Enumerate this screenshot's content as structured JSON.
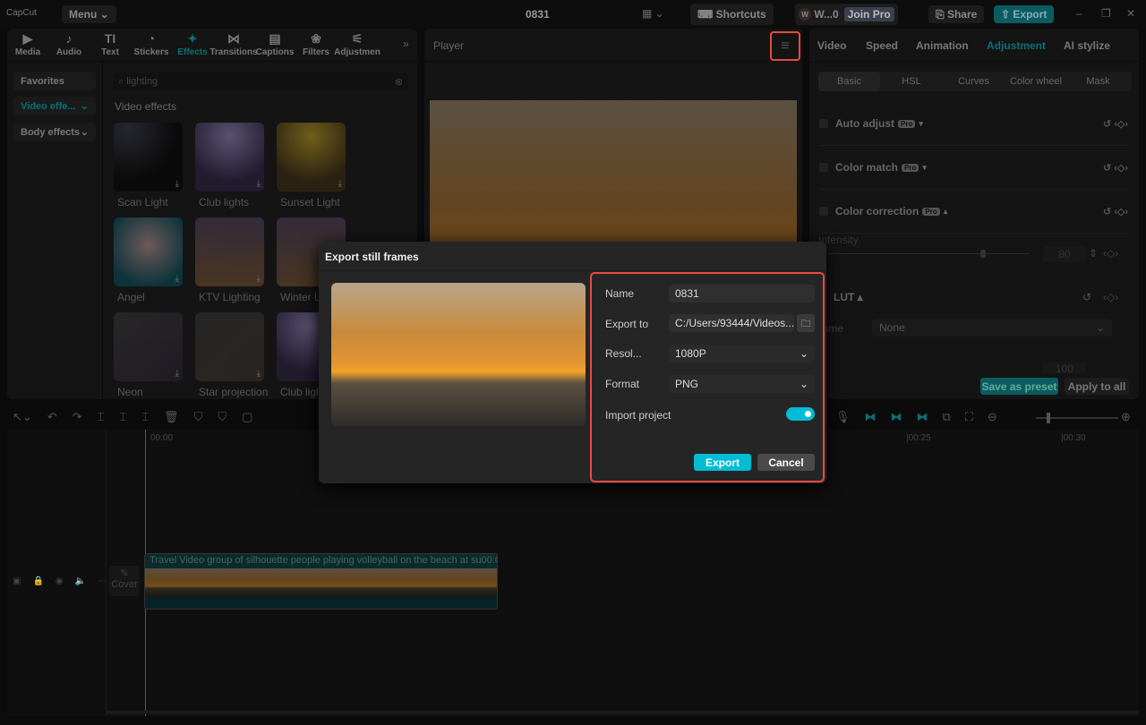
{
  "app": {
    "logo": "CapCut",
    "menu": "Menu",
    "project_title": "0831",
    "shortcuts": "Shortcuts",
    "user": "W...0",
    "user_initial": "W",
    "join_pro": "Join Pro",
    "share": "Share",
    "export": "Export"
  },
  "media_tabs": [
    {
      "label": "Media",
      "icon": "▶"
    },
    {
      "label": "Audio",
      "icon": "♪"
    },
    {
      "label": "Text",
      "icon": "TI"
    },
    {
      "label": "Stickers",
      "icon": "◔"
    },
    {
      "label": "Effects",
      "icon": "✦"
    },
    {
      "label": "Transitions",
      "icon": "⋈"
    },
    {
      "label": "Captions",
      "icon": "▤"
    },
    {
      "label": "Filters",
      "icon": "❀"
    },
    {
      "label": "Adjustmen",
      "icon": "⚟"
    }
  ],
  "effects": {
    "sidebar": [
      "Favorites",
      "Video effe...",
      "Body effects"
    ],
    "search_value": "lighting",
    "section_title": "Video effects",
    "items": [
      "Scan Light",
      "Club lights",
      "Sunset Light",
      "Angel",
      "KTV Lighting",
      "Winter L",
      "Neon",
      "Star projection",
      "Club ligh"
    ]
  },
  "player": {
    "title": "Player"
  },
  "right": {
    "tabs": [
      "Video",
      "Speed",
      "Animation",
      "Adjustment",
      "AI stylize"
    ],
    "subtabs": [
      "Basic",
      "HSL",
      "Curves",
      "Color wheel",
      "Mask"
    ],
    "rows": [
      "Auto adjust",
      "Color match",
      "Color correction"
    ],
    "pro": "Pro",
    "intensity": "Intensity",
    "intensity_value": "80",
    "lut": "LUT",
    "lut_name_label": "Name",
    "lut_name_value": "None",
    "intensity2_value": "100",
    "save_preset": "Save as preset",
    "apply_all": "Apply to all"
  },
  "timeline": {
    "t0": "00:00",
    "t25": "|00:25",
    "t30": "|00:30",
    "cover": "Cover",
    "clip_title": "Travel Video group of silhouette people playing volleyball on the beach at su",
    "clip_time": "00:0"
  },
  "dialog": {
    "title": "Export still frames",
    "name_label": "Name",
    "name_value": "0831",
    "export_to_label": "Export to",
    "export_to_value": "C:/Users/93444/Videos...",
    "resolution_label": "Resol...",
    "resolution_value": "1080P",
    "format_label": "Format",
    "format_value": "PNG",
    "import_label": "Import project",
    "import_on": true,
    "export_btn": "Export",
    "cancel_btn": "Cancel"
  },
  "colors": {
    "accent": "#00bcd4",
    "highlight": "#e84a45"
  }
}
